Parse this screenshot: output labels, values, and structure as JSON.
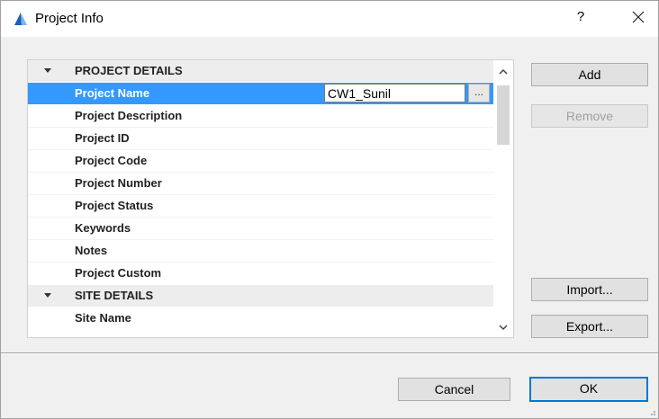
{
  "window": {
    "title": "Project Info",
    "help_label": "?",
    "app_icon": "archicad-app-icon",
    "close_icon": "close-icon"
  },
  "list": {
    "sections": [
      {
        "label": "PROJECT DETAILS",
        "expanded": true,
        "items": [
          {
            "label": "Project Name",
            "selected": true,
            "value": "CW1_Sunil",
            "browse_label": "..."
          },
          {
            "label": "Project Description"
          },
          {
            "label": "Project ID"
          },
          {
            "label": "Project Code"
          },
          {
            "label": "Project Number"
          },
          {
            "label": "Project Status"
          },
          {
            "label": "Keywords"
          },
          {
            "label": "Notes"
          },
          {
            "label": "Project Custom"
          }
        ]
      },
      {
        "label": "SITE DETAILS",
        "expanded": true,
        "items": [
          {
            "label": "Site Name"
          }
        ]
      }
    ]
  },
  "side_buttons": {
    "add": "Add",
    "remove": "Remove",
    "import": "Import...",
    "export": "Export..."
  },
  "footer": {
    "cancel": "Cancel",
    "ok": "OK"
  },
  "colors": {
    "selection": "#3399ff",
    "section_bg": "#ededed",
    "default_button_border": "#0078d7"
  }
}
